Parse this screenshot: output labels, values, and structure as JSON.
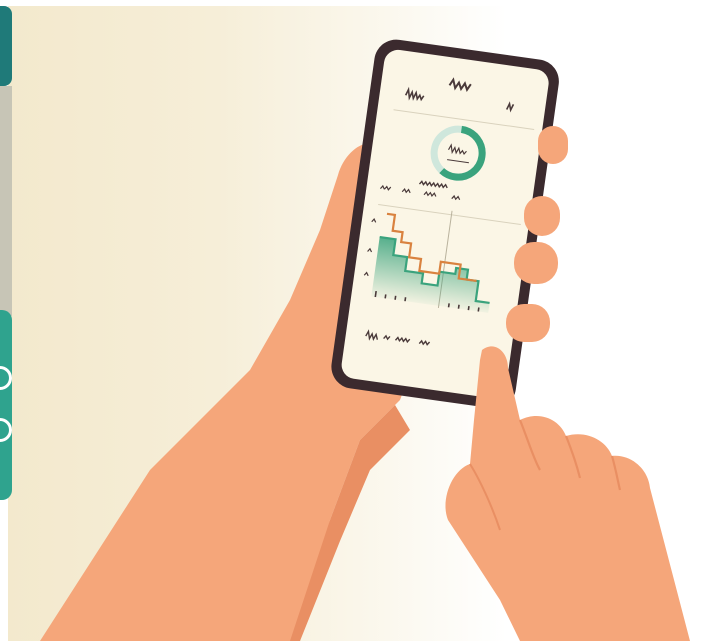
{
  "scene": {
    "description_colors": {
      "skin": "#f5a67a",
      "skin_shadow": "#e98f63",
      "phone_frame": "#3b2a2e",
      "screen_bg": "#fbf6e6",
      "accent_green": "#3aa37d",
      "accent_orange": "#d9823f",
      "teal": "#1f7a79"
    }
  },
  "phone": {
    "screen_gauge_fill_fraction": 0.6
  }
}
